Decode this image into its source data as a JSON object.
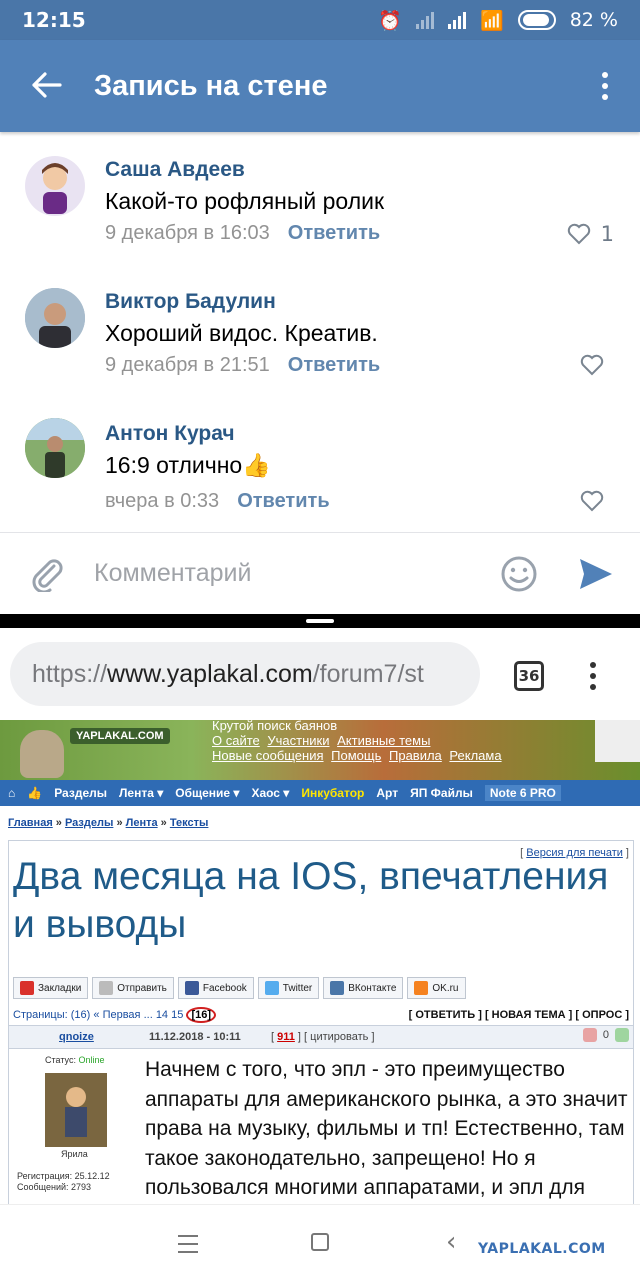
{
  "status_bar": {
    "time": "12:15",
    "battery": "82 %"
  },
  "app_bar": {
    "title": "Запись на стене"
  },
  "comments": [
    {
      "author": "Саша Авдеев",
      "text": "Какой-то рофляный ролик",
      "date": "9 декабря в 16:03",
      "reply": "Ответить",
      "likes": "1"
    },
    {
      "author": "Виктор Бадулин",
      "text": "Хороший видос. Креатив.",
      "date": "9 декабря в 21:51",
      "reply": "Ответить",
      "likes": ""
    },
    {
      "author": "Антон Курач",
      "text": "16:9 отлично👍",
      "date": "вчера в 0:33",
      "reply": "Ответить",
      "likes": ""
    }
  ],
  "composer": {
    "placeholder": "Комментарий"
  },
  "browser": {
    "url_scheme": "https://",
    "url_host": "www.yaplakal.com",
    "url_path": "/forum7/st",
    "tabs_count": "36"
  },
  "site": {
    "banner_logo": "YAPLAKAL.COM",
    "banner_links": {
      "line1": "Крутой поиск баянов",
      "line2": [
        "О сайте",
        "Участники",
        "Активные темы"
      ],
      "line3": [
        "Новые сообщения",
        "Помощь",
        "Правила",
        "Реклама"
      ]
    },
    "nav": [
      "Разделы",
      "Лента ▾",
      "Общение ▾",
      "Хаос ▾",
      "Инкубатор",
      "Арт",
      "ЯП Файлы",
      "Note 6 PRO"
    ],
    "breadcrumbs": [
      "Главная",
      "Разделы",
      "Лента",
      "Тексты"
    ],
    "print_version": "Версия для печати",
    "post_title": "Два месяца на IOS, впечатления и выводы",
    "share": [
      "Закладки",
      "Отправить",
      "Facebook",
      "Twitter",
      "ВКонтакте",
      "OK.ru"
    ],
    "pages": {
      "prefix": "Страницы:",
      "count": "(16)",
      "first": "« Первая",
      "ellipsis": "...",
      "p14": "14",
      "p15": "15",
      "current": "[16]"
    },
    "actions": "[ ОТВЕТИТЬ ] [ НОВАЯ ТЕМА ] [ ОПРОС ]",
    "post": {
      "author": "qnoize",
      "date": "11.12.2018 - 10:11",
      "rating": "911",
      "quote": "цитировать",
      "votes": "0",
      "status_label": "Статус:",
      "status_value": "Online",
      "nick": "Ярила",
      "registration": "Регистрация: 25.12.12",
      "messages": "Сообщений: 2793",
      "text": "Начнем с того, что эпл - это преимущество аппараты для американского рынка, а это значит права на музыку, фильмы и тп! Естественно, там такое законодательно, запрещено! Но я пользовался многими аппаратами, и эпл для меня стал лучшим"
    }
  },
  "watermark": "YAPLAKAL.COM",
  "colors": {
    "vk_blue": "#5181b8",
    "link_blue": "#2a5885",
    "site_nav": "#2f6bb4"
  }
}
